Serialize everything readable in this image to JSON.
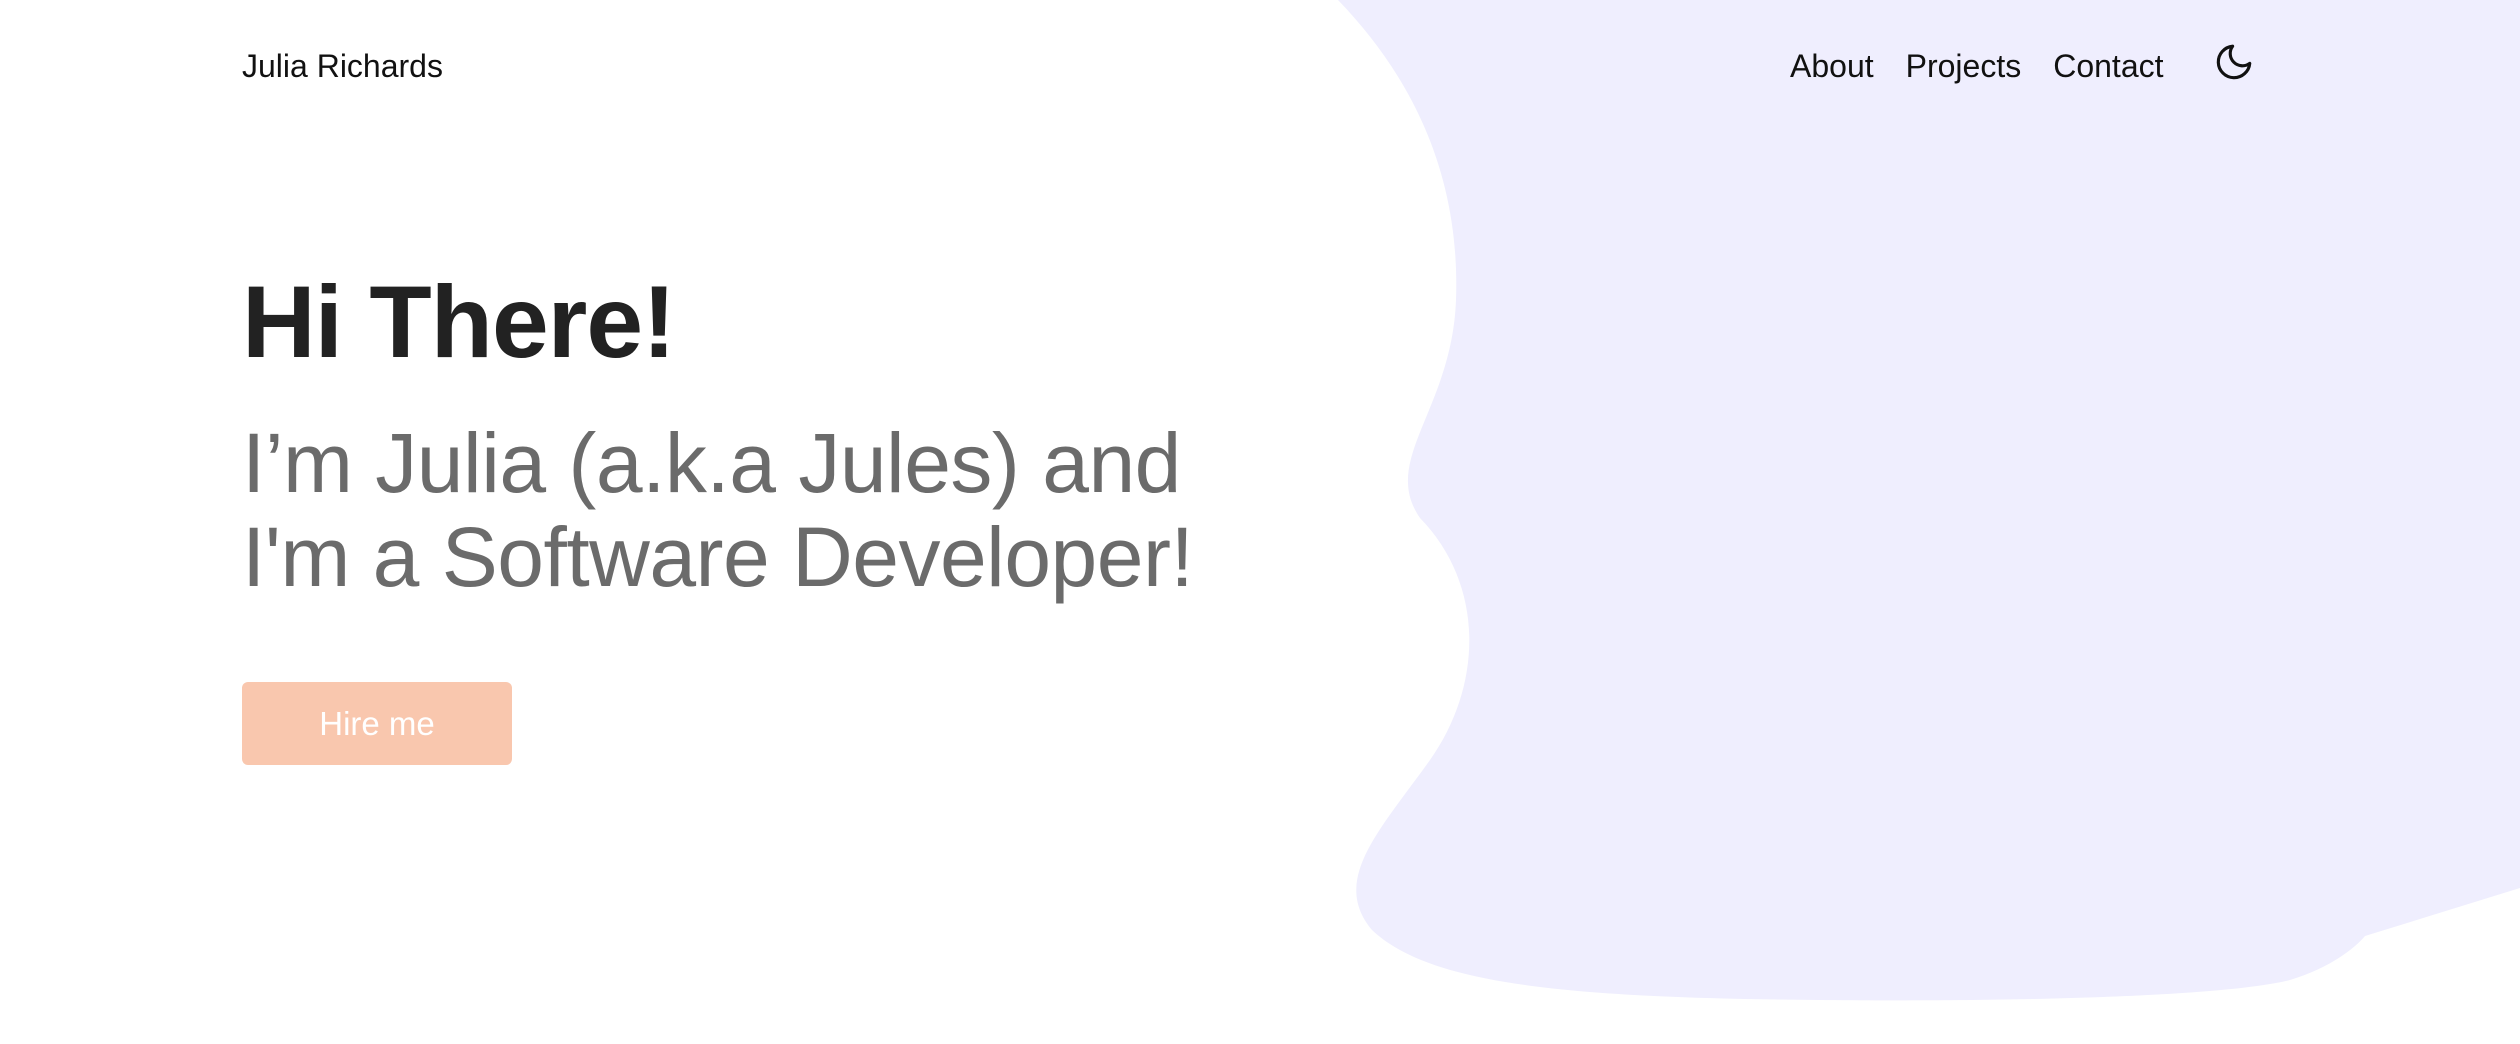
{
  "header": {
    "brand": "Julia Richards",
    "nav": [
      {
        "label": "About"
      },
      {
        "label": "Projects"
      },
      {
        "label": "Contact"
      }
    ],
    "theme_toggle_icon": "moon-icon"
  },
  "hero": {
    "title": "Hi There!",
    "subtitle_line1": "I’m Julia (a.k.a Jules) and",
    "subtitle_line2": "I'm a Software Developer!",
    "cta_label": "Hire me"
  },
  "colors": {
    "background": "#ffffff",
    "blob": "#efeefe",
    "title": "#222222",
    "subtitle": "#6b6b6b",
    "cta_background": "#f9c7ae",
    "cta_text": "#ffffff",
    "nav_text": "#111111"
  }
}
